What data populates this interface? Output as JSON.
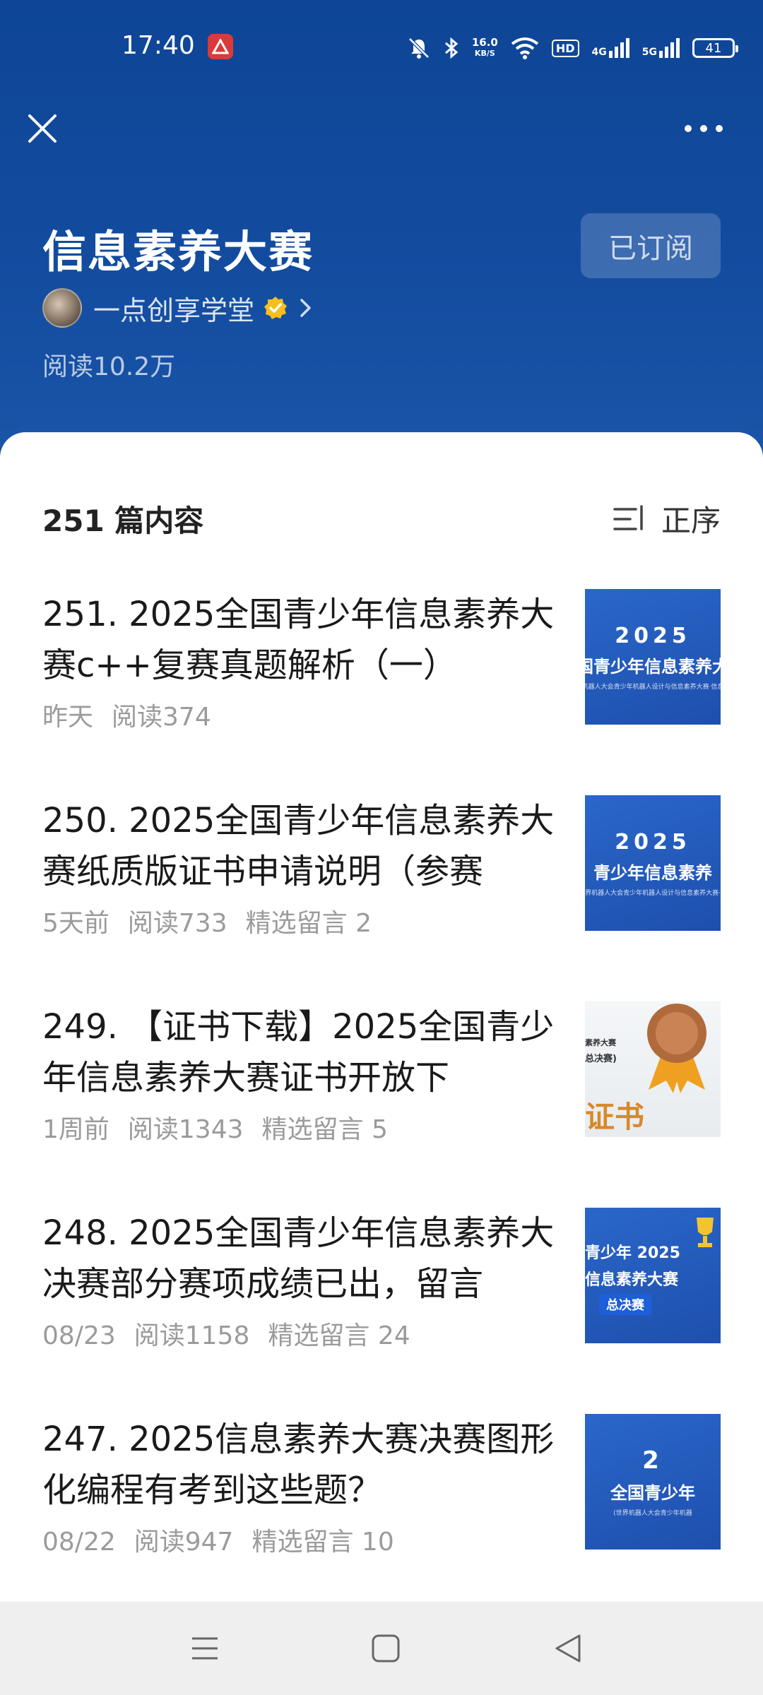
{
  "status": {
    "time": "17:40",
    "net_speed": "16.0",
    "net_unit": "KB/S",
    "hd": "HD",
    "sig1": "4G",
    "sig2": "5G",
    "battery": "41",
    "app_badge_icon": "app-red-icon"
  },
  "header": {
    "title": "信息素养大赛",
    "subscribe_label": "已订阅",
    "author": "一点创享学堂",
    "reads": "阅读10.2万",
    "accent": "#134c9f"
  },
  "list": {
    "count": "251 篇内容",
    "sort_label": "正序"
  },
  "articles": [
    {
      "title": "251. 2025全国青少年信息素养大赛c++复赛真题解析（一）",
      "time": "昨天",
      "reads": "阅读374",
      "comments": "",
      "thumb": {
        "style": "blue",
        "line1": "2025",
        "line2": "国青少年信息素养大",
        "line3": "世界机器人大会青少年机器人设计与信息素养大赛·信息素养"
      }
    },
    {
      "title": "250. 2025全国青少年信息素养大赛纸质版证书申请说明（参赛",
      "time": "5天前",
      "reads": "阅读733",
      "comments": "精选留言 2",
      "thumb": {
        "style": "blue",
        "line1": "2025",
        "line2": "青少年信息素养",
        "line3": "世界机器人大会青少年机器人设计与信息素养大赛·信"
      }
    },
    {
      "title": "249. 【证书下载】2025全国青少年信息素养大赛证书开放下",
      "time": "1周前",
      "reads": "阅读1343",
      "comments": "精选留言 5",
      "thumb": {
        "style": "cert",
        "line1": "素养大赛",
        "line2": "总决赛)",
        "line3": "证书"
      }
    },
    {
      "title": "248. 2025全国青少年信息素养大决赛部分赛项成绩已出，留言",
      "time": "08/23",
      "reads": "阅读1158",
      "comments": "精选留言 24",
      "thumb": {
        "style": "blue",
        "line1": "青少年 2025",
        "line2": "信息素养大赛",
        "line3": "总决赛"
      }
    },
    {
      "title": "247. 2025信息素养大赛决赛图形化编程有考到这些题？",
      "time": "08/22",
      "reads": "阅读947",
      "comments": "精选留言 10",
      "thumb": {
        "style": "blue",
        "line1": "2",
        "line2": "全国青少年",
        "line3": "(世界机器人大会青少年机器"
      }
    }
  ]
}
